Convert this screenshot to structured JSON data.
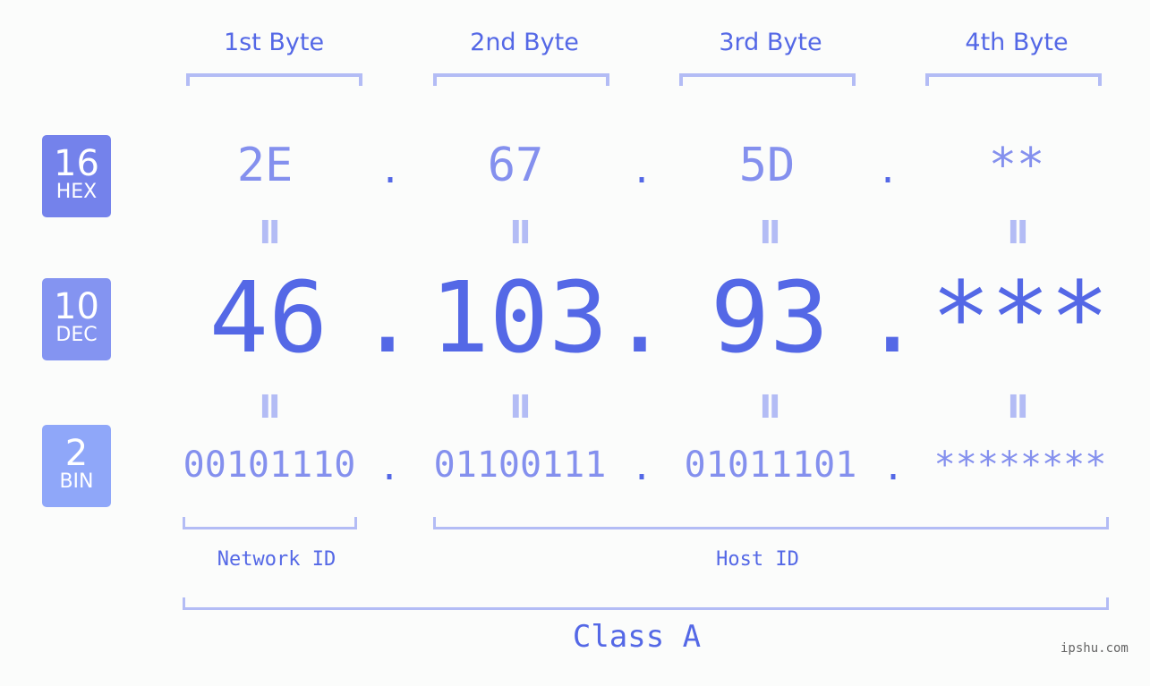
{
  "byte_headers": [
    "1st Byte",
    "2nd Byte",
    "3rd Byte",
    "4th Byte"
  ],
  "badges": [
    {
      "num": "16",
      "label": "HEX",
      "color": "#7482eb"
    },
    {
      "num": "10",
      "label": "DEC",
      "color": "#8494f1"
    },
    {
      "num": "2",
      "label": "BIN",
      "color": "#8fa7f9"
    }
  ],
  "hex": [
    "2E",
    "67",
    "5D",
    "**"
  ],
  "dec": [
    "46",
    "103",
    "93",
    "***"
  ],
  "bin": [
    "00101110",
    "01100111",
    "01011101",
    "********"
  ],
  "separator": ".",
  "equals": "II",
  "network_id_label": "Network ID",
  "host_id_label": "Host ID",
  "class_label": "Class A",
  "watermark": "ipshu.com"
}
